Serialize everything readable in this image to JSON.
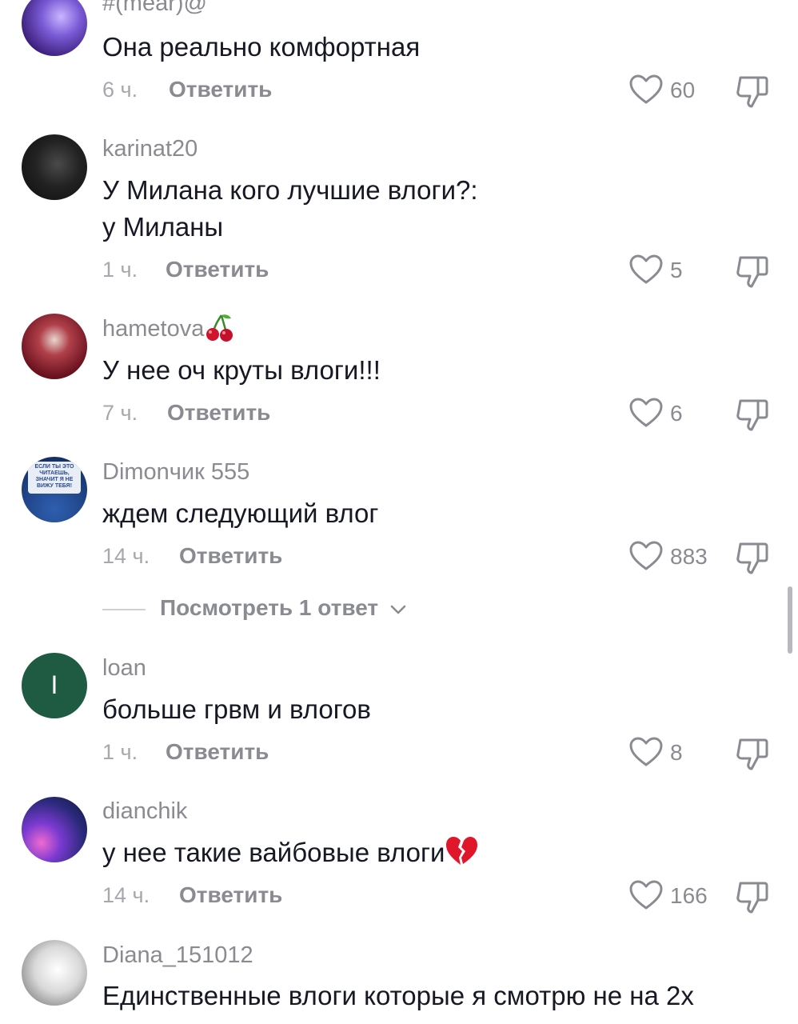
{
  "colors": {
    "text": "#161823",
    "secondary": "#8a8b91",
    "meta": "#a7a8ad"
  },
  "comments": [
    {
      "username": "#(mear)@",
      "text": "Она реально комфортная",
      "time": "6 ч.",
      "reply": "Ответить",
      "likes": "60"
    },
    {
      "username": "karinat20",
      "text": "У Милана кого лучшие влоги?:\nу Миланы",
      "time": "1 ч.",
      "reply": "Ответить",
      "likes": "5"
    },
    {
      "username": "hametova",
      "text": "У нее оч круты влоги!!!",
      "time": "7 ч.",
      "reply": "Ответить",
      "likes": "6"
    },
    {
      "username": "Dimonчик 555",
      "text": "ждем следующий влог",
      "time": "14 ч.",
      "reply": "Ответить",
      "likes": "883",
      "avatar_text": "ЕСЛИ ТЫ ЭТО ЧИТАЕШЬ, ЗНАЧИТ Я НЕ ВИЖУ ТЕБЯ!"
    },
    {
      "username": "loan",
      "text": "больше грвм и влогов",
      "time": "1 ч.",
      "reply": "Ответить",
      "likes": "8",
      "avatar_letter": "I"
    },
    {
      "username": "dianchik",
      "text": "у нее такие вайбовые влоги",
      "time": "14 ч.",
      "reply": "Ответить",
      "likes": "166"
    },
    {
      "username": "Diana_151012",
      "text": "Единственные влоги которые я смотрю не на 2x"
    }
  ],
  "view_replies": "Посмотреть 1 ответ",
  "icons": {
    "like": "heart-icon",
    "dislike": "dislike-icon",
    "chevron": "chevron-down-icon",
    "cherry": "cherry-emoji",
    "broken_heart": "broken-heart-emoji"
  }
}
